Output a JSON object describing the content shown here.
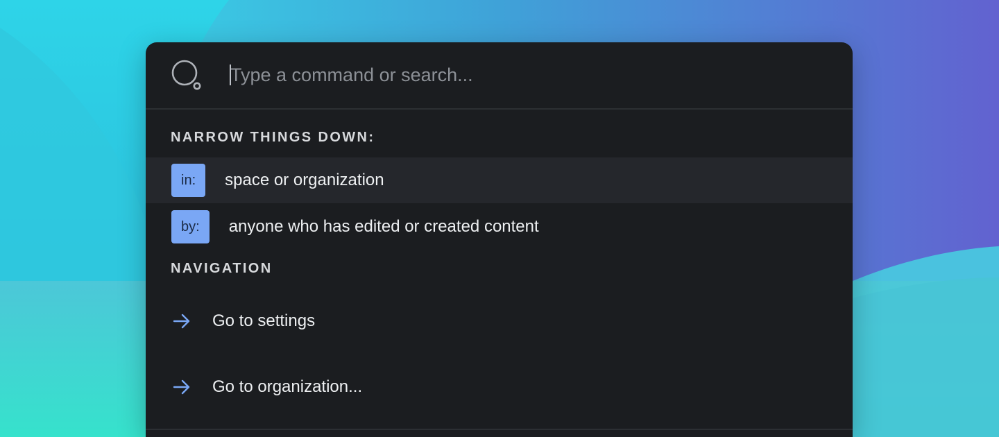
{
  "search": {
    "placeholder": "Type a command or search...",
    "icon": "search-icon"
  },
  "sections": {
    "filters_title": "NARROW THINGS DOWN:",
    "navigation_title": "NAVIGATION"
  },
  "filters": [
    {
      "chip": "in:",
      "label": "space or organization",
      "active": true
    },
    {
      "chip": "by:",
      "label": "anyone who has edited or created content",
      "active": false
    }
  ],
  "navigation": [
    {
      "icon": "arrow-right-icon",
      "label": "Go to settings"
    },
    {
      "icon": "arrow-right-icon",
      "label": "Go to organization..."
    }
  ],
  "colors": {
    "panel": "#1b1d20",
    "chip": "#7aa7f5",
    "arrow": "#7aa7f5",
    "active_row": "#25272c"
  }
}
